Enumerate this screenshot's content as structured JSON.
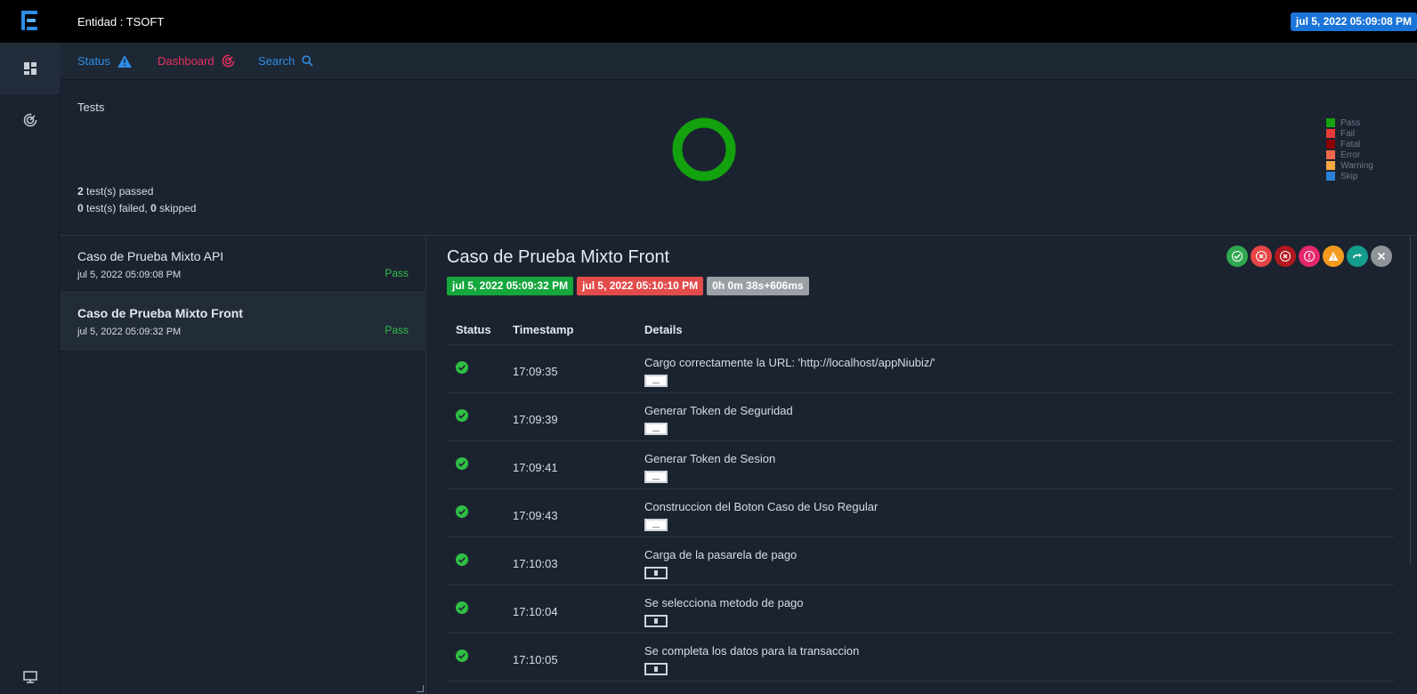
{
  "header": {
    "entity": "Entidad : TSOFT",
    "date": "jul 5, 2022 05:09:08 PM"
  },
  "nav": {
    "items": [
      {
        "label": "Status",
        "icon": "warning-icon",
        "color": "#2e8ee6"
      },
      {
        "label": "Dashboard",
        "icon": "dashboard-icon",
        "color": "#e8315e"
      },
      {
        "label": "Search",
        "icon": "search-icon",
        "color": "#2e8ee6"
      }
    ]
  },
  "summary": {
    "title": "Tests",
    "passed_count": "2",
    "passed_text": "test(s) passed",
    "failed_count": "0",
    "failed_text": "test(s) failed,",
    "skipped_count": "0",
    "skipped_text": "skipped",
    "legend": [
      {
        "label": "Pass",
        "color": "#13a10e"
      },
      {
        "label": "Fail",
        "color": "#e63b3b"
      },
      {
        "label": "Fatal",
        "color": "#8b0000"
      },
      {
        "label": "Error",
        "color": "#f2684a"
      },
      {
        "label": "Warning",
        "color": "#f5a742"
      },
      {
        "label": "Skip",
        "color": "#2a7fd8"
      }
    ]
  },
  "tests": [
    {
      "name": "Caso de Prueba Mixto API",
      "date": "jul 5, 2022 05:09:08 PM",
      "status": "Pass"
    },
    {
      "name": "Caso de Prueba Mixto Front",
      "date": "jul 5, 2022 05:09:32 PM",
      "status": "Pass"
    }
  ],
  "detail": {
    "title": "Caso de Prueba Mixto Front",
    "start": "jul 5, 2022 05:09:32 PM",
    "end": "jul 5, 2022 05:10:10 PM",
    "duration": "0h 0m 38s+606ms",
    "columns": {
      "status": "Status",
      "timestamp": "Timestamp",
      "details": "Details"
    },
    "rows": [
      {
        "time": "17:09:35",
        "details": "Cargo correctamente la URL: 'http://localhost/appNiubiz/'"
      },
      {
        "time": "17:09:39",
        "details": "Generar Token de Seguridad"
      },
      {
        "time": "17:09:41",
        "details": "Generar Token de Sesion"
      },
      {
        "time": "17:09:43",
        "details": "Construccion del Boton Caso de Uso Regular"
      },
      {
        "time": "17:10:03",
        "details": "Carga de la pasarela de pago"
      },
      {
        "time": "17:10:04",
        "details": "Se selecciona metodo de pago"
      },
      {
        "time": "17:10:05",
        "details": "Se completa los datos para la transaccion"
      }
    ]
  }
}
